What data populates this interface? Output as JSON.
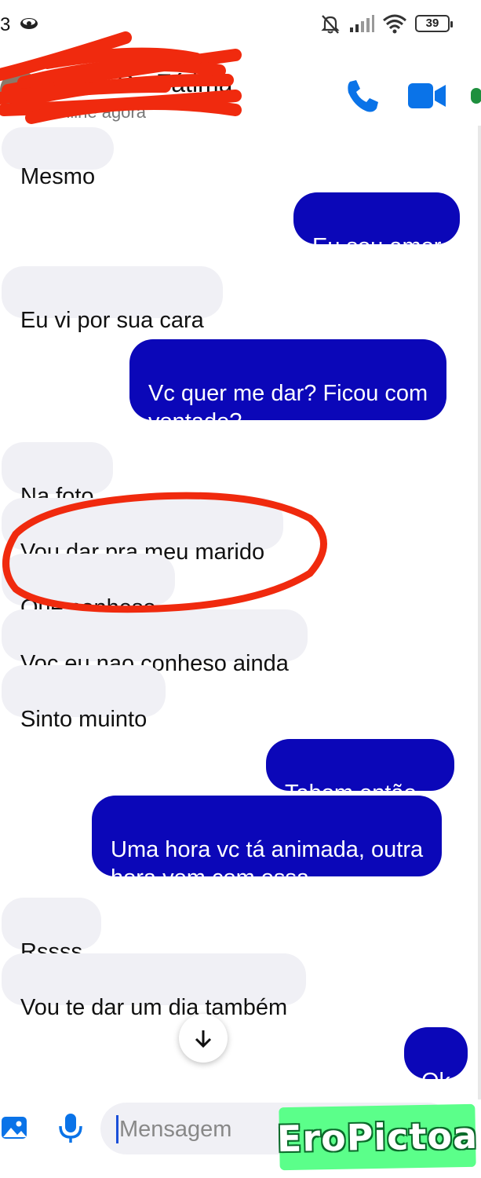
{
  "status_bar": {
    "time": "3",
    "battery": "39"
  },
  "header": {
    "contact_name": "Maria De Fátima",
    "contact_status": "Online agora"
  },
  "messages": [
    {
      "dir": "in",
      "text": "Mesmo"
    },
    {
      "dir": "out",
      "text": "Eu sou amor"
    },
    {
      "dir": "in",
      "text": "Eu vi por sua cara"
    },
    {
      "dir": "out",
      "text": "Vc quer me dar? Ficou com\nvontade?"
    },
    {
      "dir": "in",
      "text": "Na foto"
    },
    {
      "dir": "in",
      "text": "Vou dar pra meu marido"
    },
    {
      "dir": "in",
      "text": "Que conheso"
    },
    {
      "dir": "in",
      "text": "Voc eu nao conheso ainda"
    },
    {
      "dir": "in",
      "text": "Sinto muinto"
    },
    {
      "dir": "out",
      "text": "Tabom então..."
    },
    {
      "dir": "out",
      "text": "Uma hora vc tá animada, outra\nhora vem com essa"
    },
    {
      "dir": "in",
      "text": "Rssss"
    },
    {
      "dir": "in",
      "text": "Vou te dar um dia também"
    },
    {
      "dir": "out",
      "text": "Ok"
    }
  ],
  "composer": {
    "placeholder": "Mensagem"
  },
  "watermark": "EroPictoa",
  "colors": {
    "outgoing_bubble": "#0b07b8",
    "incoming_bubble": "#f0f0f5",
    "accent_blue": "#0a73e8",
    "annotation_red": "#f02a0e",
    "watermark_green": "#5bff8a"
  },
  "icons": [
    "eye-icon",
    "muted-bell-icon",
    "signal-icon",
    "wifi-icon",
    "battery-icon",
    "phone-icon",
    "video-camera-icon",
    "gallery-icon",
    "microphone-icon",
    "arrow-down-icon"
  ]
}
